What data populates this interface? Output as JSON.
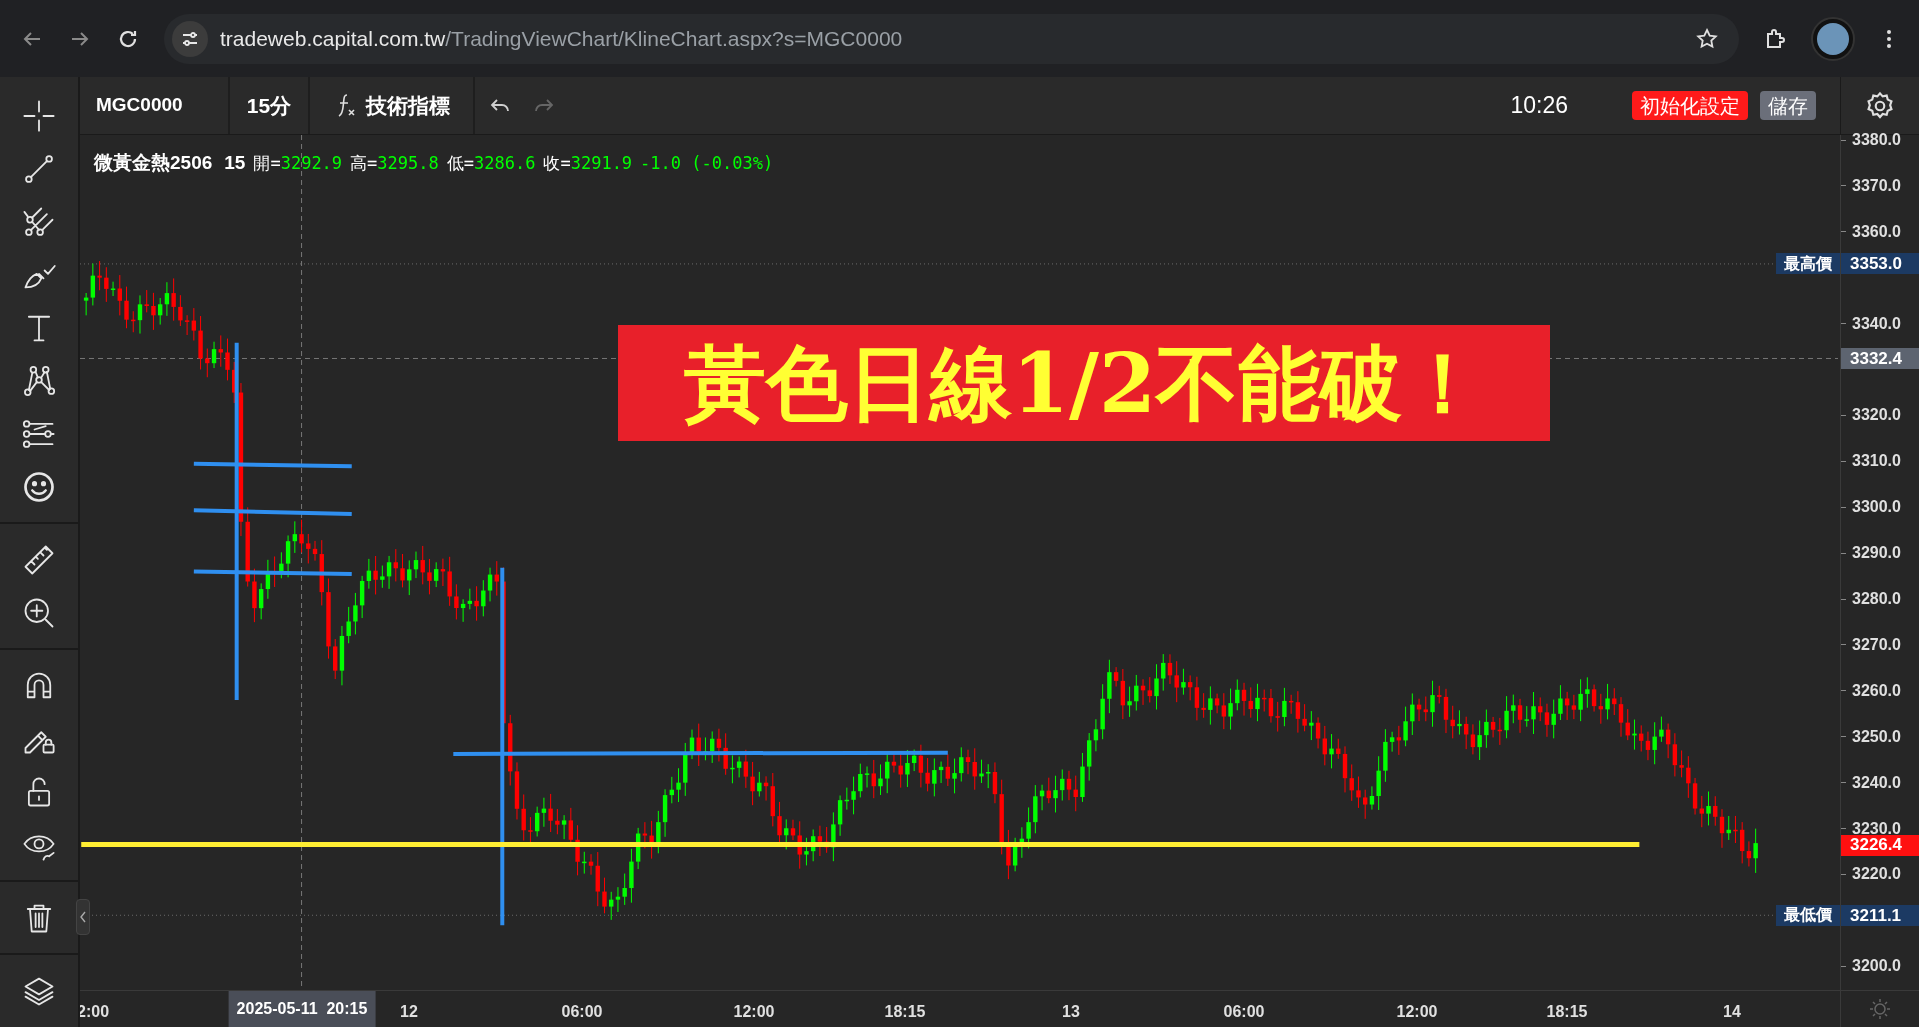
{
  "browser": {
    "url_host": "tradeweb.capital.com.tw",
    "url_path": "/TradingViewChart/KlineChart.aspx?s=MGC0000"
  },
  "toolbar": {
    "symbol": "MGC0000",
    "interval": "15分",
    "indicators_label": "技術指標",
    "time": "10:26",
    "reset_button": "初始化設定",
    "save_button": "儲存"
  },
  "legend": {
    "name": "微黃金熱2506",
    "interval": "15",
    "fields": [
      {
        "label": "開=",
        "value": "3292.9"
      },
      {
        "label": "高=",
        "value": "3295.8"
      },
      {
        "label": "低=",
        "value": "3286.6"
      },
      {
        "label": "收=",
        "value": "3291.9"
      }
    ],
    "change": "-1.0 (-0.03%)"
  },
  "banner": "黃色日線1/2不能破！",
  "price_axis": {
    "ticks": [
      "3380.0",
      "3370.0",
      "3360.0",
      "3340.0",
      "3320.0",
      "3310.0",
      "3300.0",
      "3290.0",
      "3280.0",
      "3270.0",
      "3260.0",
      "3250.0",
      "3240.0",
      "3230.0",
      "3220.0",
      "3200.0"
    ],
    "markers": [
      {
        "kind": "high",
        "label": "最高價",
        "value": "3353.0"
      },
      {
        "kind": "crosshair",
        "value": "3332.4"
      },
      {
        "kind": "last",
        "value": "3226.4"
      },
      {
        "kind": "low",
        "label": "最低價",
        "value": "3211.1"
      }
    ]
  },
  "time_axis": {
    "labels": [
      "2:00",
      "12",
      "06:00",
      "12:00",
      "18:15",
      "13",
      "06:00",
      "12:00",
      "18:15",
      "14"
    ],
    "crosshair": "2025-05-11  20:15"
  }
}
